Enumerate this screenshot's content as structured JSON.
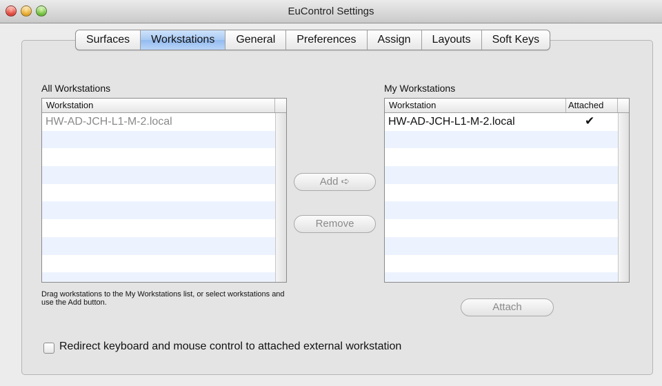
{
  "window": {
    "title": "EuControl Settings"
  },
  "tabs": [
    {
      "label": "Surfaces",
      "active": false
    },
    {
      "label": "Workstations",
      "active": true
    },
    {
      "label": "General",
      "active": false
    },
    {
      "label": "Preferences",
      "active": false
    },
    {
      "label": "Assign",
      "active": false
    },
    {
      "label": "Layouts",
      "active": false
    },
    {
      "label": "Soft Keys",
      "active": false
    }
  ],
  "all_workstations": {
    "title": "All Workstations",
    "column": "Workstation",
    "rows": [
      "HW-AD-JCH-L1-M-2.local"
    ]
  },
  "my_workstations": {
    "title": "My Workstations",
    "columns": {
      "workstation": "Workstation",
      "attached": "Attached"
    },
    "rows": [
      {
        "name": "HW-AD-JCH-L1-M-2.local",
        "attached": "✔"
      }
    ]
  },
  "buttons": {
    "add": "Add ➪",
    "remove": "Remove",
    "attach": "Attach"
  },
  "help_text": "Drag workstations to the My Workstations list, or select workstations and use the Add button.",
  "redirect_checkbox": {
    "label": "Redirect keyboard and mouse control to attached external workstation",
    "checked": false
  },
  "colors": {
    "active_tab": "#a7c9f3",
    "row_stripe": "#edf3fe",
    "window_bg": "#ececec"
  }
}
